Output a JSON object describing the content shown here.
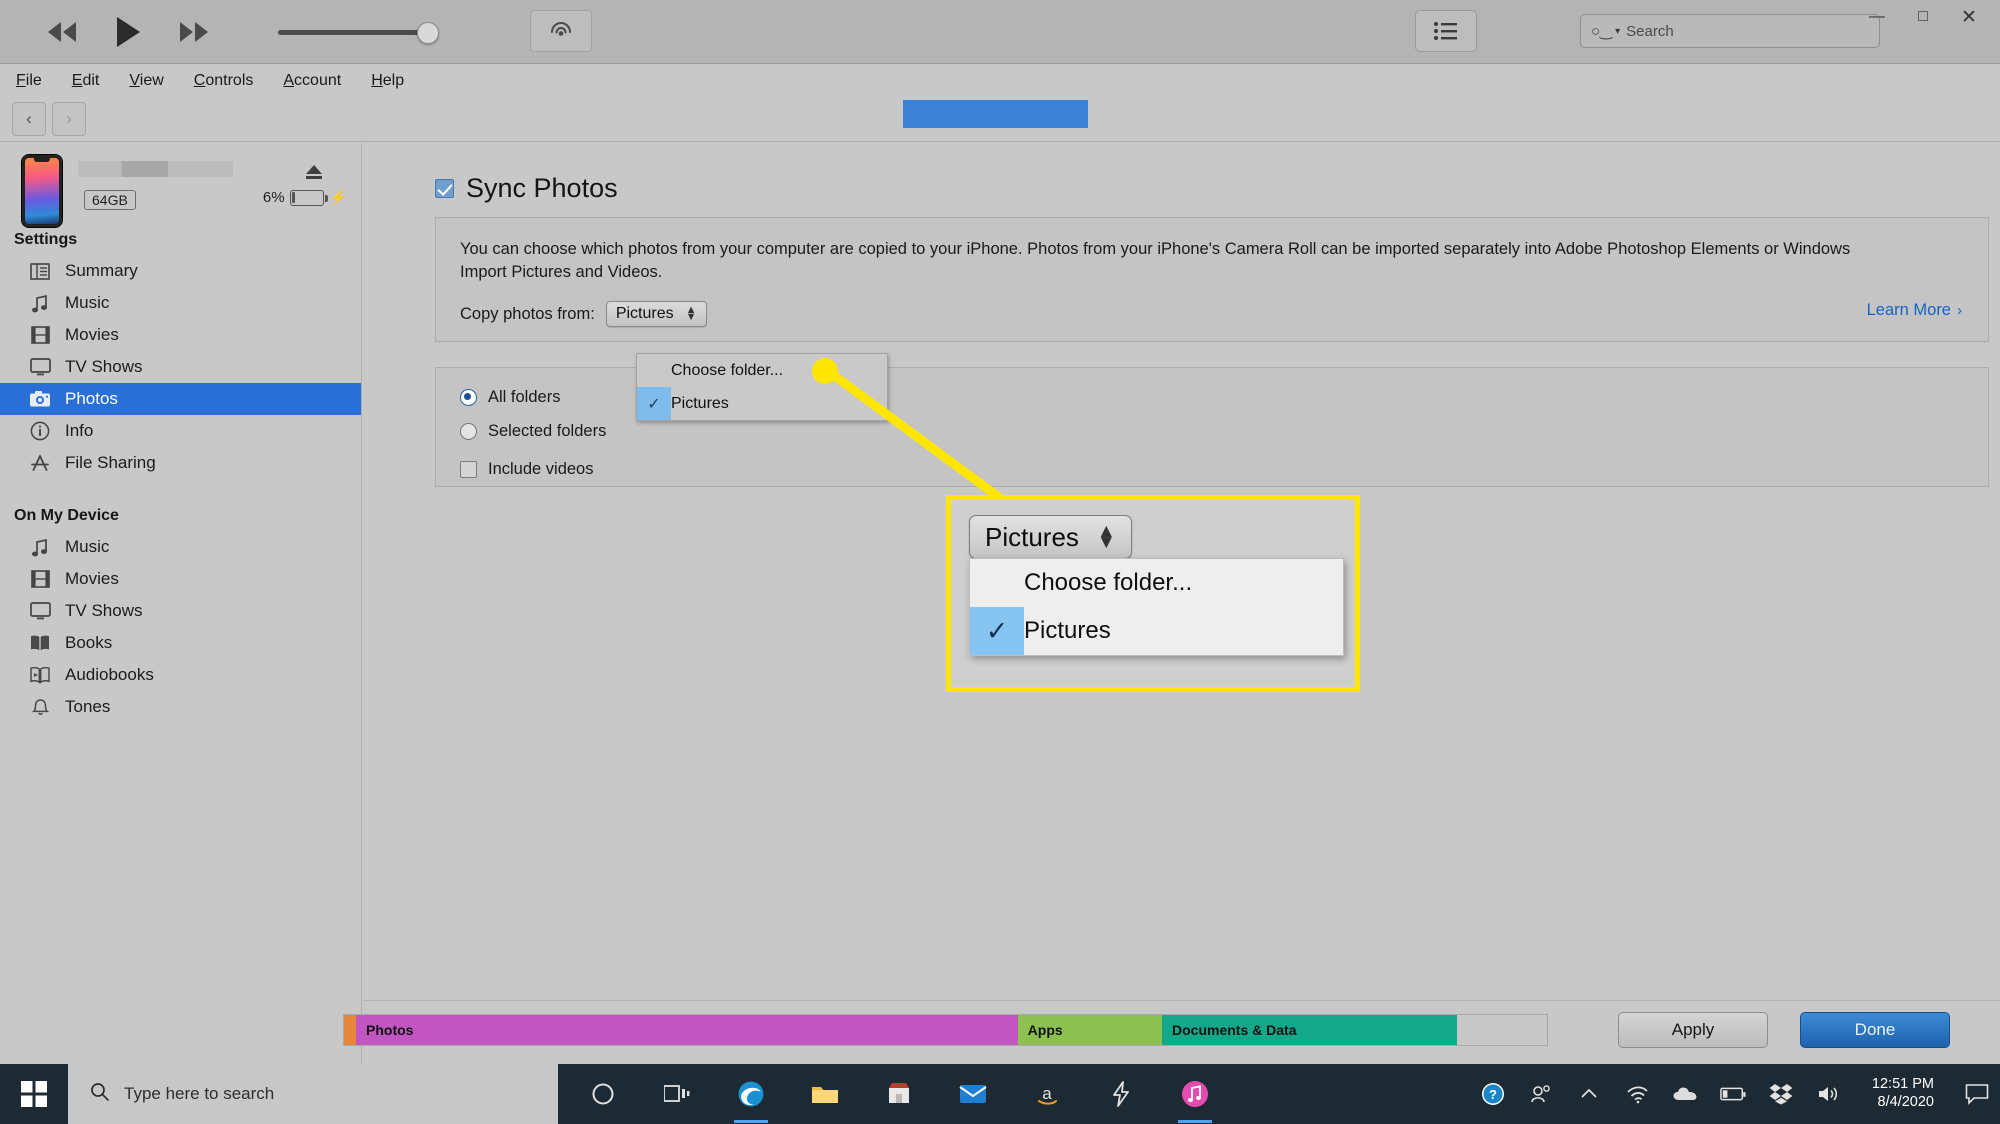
{
  "titlebar": {
    "rewind_icon": "rewind-icon",
    "play_icon": "play-icon",
    "forward_icon": "fast-forward-icon",
    "airplay_icon": "airplay-icon",
    "apple_logo": "apple-logo-icon",
    "library_icon": "library-list-icon",
    "search_placeholder": "Search",
    "search_value": "",
    "minimize_label": "—",
    "maximize_label": "□",
    "close_label": "✕"
  },
  "menubar": {
    "items": [
      {
        "label": "File",
        "accel": "F"
      },
      {
        "label": "Edit",
        "accel": "E"
      },
      {
        "label": "View",
        "accel": "V"
      },
      {
        "label": "Controls",
        "accel": "C"
      },
      {
        "label": "Account",
        "accel": "A"
      },
      {
        "label": "Help",
        "accel": "H"
      }
    ]
  },
  "navstrip": {
    "back_label": "‹",
    "forward_label": "›"
  },
  "device": {
    "name_redacted": "",
    "capacity": "64GB",
    "battery_percent": "6%",
    "eject_icon": "eject-icon",
    "battery_icon": "battery-charging-icon"
  },
  "sidebar": {
    "settings_header": "Settings",
    "settings_items": [
      {
        "label": "Summary",
        "icon": "summary-icon",
        "selected": false
      },
      {
        "label": "Music",
        "icon": "music-note-icon",
        "selected": false
      },
      {
        "label": "Movies",
        "icon": "film-icon",
        "selected": false
      },
      {
        "label": "TV Shows",
        "icon": "tv-icon",
        "selected": false
      },
      {
        "label": "Photos",
        "icon": "camera-icon",
        "selected": true
      },
      {
        "label": "Info",
        "icon": "info-circle-icon",
        "selected": false
      },
      {
        "label": "File Sharing",
        "icon": "app-store-a-icon",
        "selected": false
      }
    ],
    "device_header": "On My Device",
    "device_items": [
      {
        "label": "Music",
        "icon": "music-note-icon"
      },
      {
        "label": "Movies",
        "icon": "film-icon"
      },
      {
        "label": "TV Shows",
        "icon": "tv-icon"
      },
      {
        "label": "Books",
        "icon": "book-icon"
      },
      {
        "label": "Audiobooks",
        "icon": "audiobook-icon"
      },
      {
        "label": "Tones",
        "icon": "bell-icon"
      }
    ]
  },
  "main": {
    "sync_photos_label": "Sync Photos",
    "sync_photos_checked": true,
    "description": "You can choose which photos from your computer are copied to your iPhone. Photos from your iPhone's Camera Roll can be imported separately into Adobe Photoshop Elements or Windows Import Pictures and Videos.",
    "copy_from_label": "Copy photos from:",
    "copy_from_value": "Pictures",
    "learn_more_label": "Learn More",
    "learn_more_chevron": "›",
    "folder_options": [
      {
        "label": "All folders",
        "selected": true
      },
      {
        "label": "Selected folders",
        "selected": false
      }
    ],
    "include_videos_label": "Include videos",
    "include_videos_checked": false,
    "dropdown": {
      "items": [
        {
          "label": "Choose folder...",
          "checked": false
        },
        {
          "label": "Pictures",
          "checked": true
        }
      ],
      "checkmark": "✓"
    }
  },
  "callout": {
    "select_value": "Pictures",
    "items": [
      {
        "label": "Choose folder...",
        "checked": false
      },
      {
        "label": "Pictures",
        "checked": true
      }
    ],
    "checkmark": "✓",
    "highlight_color": "#ffe600"
  },
  "footer": {
    "capacity_segments": [
      {
        "label": "",
        "color": "#e8863c",
        "width_pct": 1.0
      },
      {
        "label": "Photos",
        "color": "#c155c1",
        "width_pct": 55.0
      },
      {
        "label": "Apps",
        "color": "#8cc152",
        "width_pct": 12.0
      },
      {
        "label": "Documents & Data",
        "color": "#14a88b",
        "width_pct": 24.5
      },
      {
        "label": "",
        "color": "#c8c8c8",
        "width_pct": 7.5
      }
    ],
    "apply_label": "Apply",
    "done_label": "Done"
  },
  "taskbar": {
    "start_icon": "windows-start-icon",
    "search_placeholder": "Type here to search",
    "search_icon": "search-icon",
    "items": [
      {
        "icon": "cortana-circle-icon",
        "name": "cortana",
        "active": false
      },
      {
        "icon": "task-view-icon",
        "name": "task-view",
        "active": false
      },
      {
        "icon": "edge-icon",
        "name": "edge",
        "active": true
      },
      {
        "icon": "file-explorer-icon",
        "name": "explorer",
        "active": false
      },
      {
        "icon": "microsoft-store-icon",
        "name": "store",
        "active": false
      },
      {
        "icon": "mail-icon",
        "name": "mail",
        "active": false
      },
      {
        "icon": "amazon-icon",
        "name": "amazon",
        "active": false
      },
      {
        "icon": "lightning-icon",
        "name": "flash-app",
        "active": false
      },
      {
        "icon": "itunes-icon",
        "name": "itunes",
        "active": true
      }
    ],
    "tray": [
      {
        "icon": "help-circle-icon",
        "name": "help"
      },
      {
        "icon": "people-icon",
        "name": "people"
      },
      {
        "icon": "chevron-up-icon",
        "name": "show-hidden-icons"
      },
      {
        "icon": "wifi-icon",
        "name": "network"
      },
      {
        "icon": "onedrive-icon",
        "name": "onedrive"
      },
      {
        "icon": "battery-icon",
        "name": "battery"
      },
      {
        "icon": "dropbox-icon",
        "name": "dropbox"
      },
      {
        "icon": "volume-icon",
        "name": "volume"
      }
    ],
    "time": "12:51 PM",
    "date": "8/4/2020",
    "action_center_icon": "action-center-icon"
  }
}
